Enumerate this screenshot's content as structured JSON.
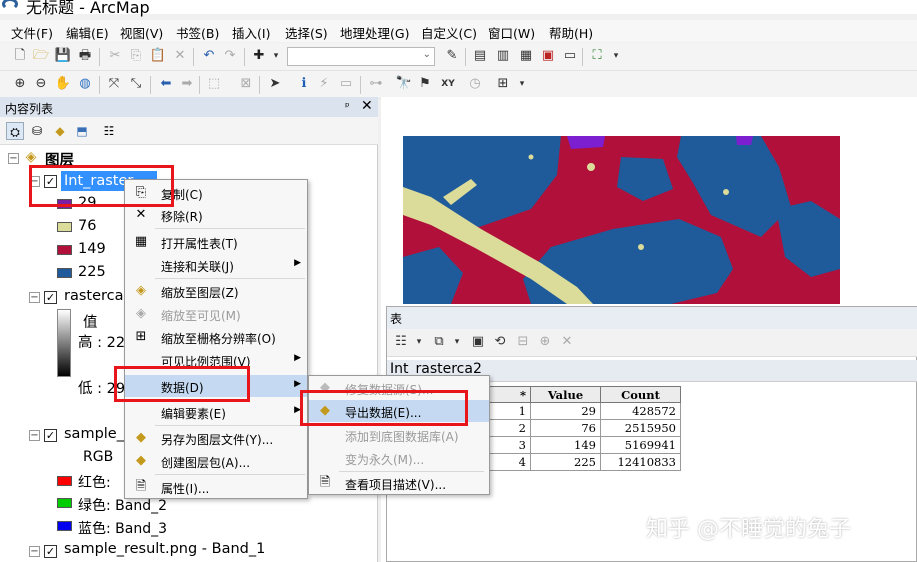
{
  "window": {
    "title": "无标题 - ArcMap"
  },
  "menubar": [
    {
      "label": "文件(F)"
    },
    {
      "label": "编辑(E)"
    },
    {
      "label": "视图(V)"
    },
    {
      "label": "书签(B)"
    },
    {
      "label": "插入(I)"
    },
    {
      "label": "选择(S)"
    },
    {
      "label": "地理处理(G)"
    },
    {
      "label": "自定义(C)"
    },
    {
      "label": "窗口(W)"
    },
    {
      "label": "帮助(H)"
    }
  ],
  "toc": {
    "title": "内容列表",
    "pin": "ᵖ",
    "close": "✕",
    "root": "图层",
    "layer1": {
      "name": "Int_raster",
      "classes": [
        {
          "label": "29",
          "color": "#7b1fa2"
        },
        {
          "label": "76",
          "color": "#dcdc9a"
        },
        {
          "label": "149",
          "color": "#b0103a"
        },
        {
          "label": "225",
          "color": "#1f5a9a"
        }
      ]
    },
    "layer2": {
      "name": "rasterca",
      "value_label": "值",
      "high_label": "高 : 22",
      "low_label": "低 : 29"
    },
    "layer3": {
      "name": "sample_",
      "rgb": "RGB",
      "red": "红色:",
      "green": "绿色: Band_2",
      "blue": "蓝色:  Band_3",
      "red_color": "#ff0000",
      "green_color": "#00cc00",
      "blue_color": "#0000ee"
    },
    "layer4": {
      "name": "sample_result.png - Band_1"
    }
  },
  "context_menu": {
    "items": [
      {
        "label": "复制(C)",
        "icon": "copy-icon"
      },
      {
        "label": "移除(R)",
        "icon": "remove-icon"
      },
      {
        "label": "打开属性表(T)",
        "icon": "table-icon"
      },
      {
        "label": "连接和关联(J)",
        "icon": ""
      },
      {
        "label": "缩放至图层(Z)",
        "icon": "zoom-layer-icon"
      },
      {
        "label": "缩放至可见(M)",
        "icon": "zoom-visible-icon"
      },
      {
        "label": "缩放至栅格分辨率(O)",
        "icon": "zoom-raster-icon"
      },
      {
        "label": "可见比例范围(V)",
        "icon": ""
      },
      {
        "label": "数据(D)",
        "icon": ""
      },
      {
        "label": "编辑要素(E)",
        "icon": ""
      },
      {
        "label": "另存为图层文件(Y)...",
        "icon": "save-layer-icon"
      },
      {
        "label": "创建图层包(A)...",
        "icon": "layer-package-icon"
      },
      {
        "label": "属性(I)...",
        "icon": "properties-icon"
      }
    ]
  },
  "data_submenu": {
    "items": [
      {
        "label": "修复数据源(S)..."
      },
      {
        "label": "导出数据(E)..."
      },
      {
        "label": "添加到底图数据库(A)"
      },
      {
        "label": "变为永久(M)..."
      },
      {
        "label": "查看项目描述(V)..."
      }
    ]
  },
  "table_window": {
    "title": "表",
    "table_name": "Int_rasterca2",
    "columns": [
      "* ",
      "Value",
      "Count"
    ],
    "rows": [
      {
        "oid": "1",
        "value": "29",
        "count": "428572"
      },
      {
        "oid": "2",
        "value": "76",
        "count": "2515950"
      },
      {
        "oid": "3",
        "value": "149",
        "count": "5169941"
      },
      {
        "oid": "4",
        "value": "225",
        "count": "12410833"
      }
    ]
  },
  "map_colors": {
    "purple": "#7b1fd0",
    "yellow": "#dcdc9a",
    "crimson": "#b0103a",
    "blue": "#1f5a9a"
  },
  "watermark": "知乎 @不睡觉的兔子"
}
